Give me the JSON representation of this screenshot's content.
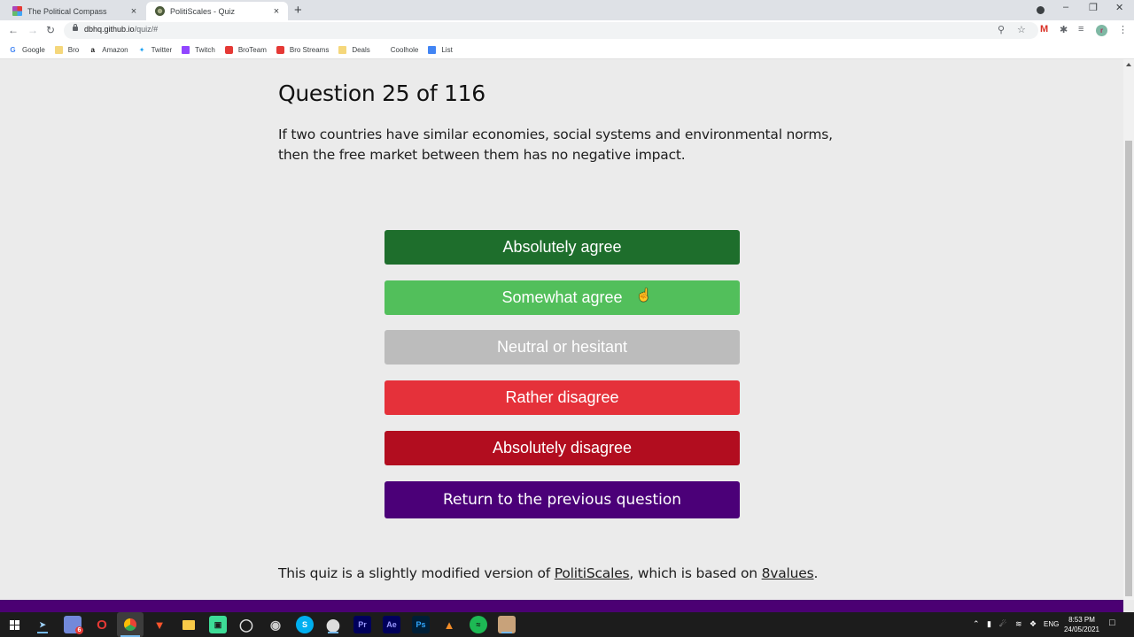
{
  "browser": {
    "tabs": [
      {
        "title": "The Political Compass",
        "active": false,
        "favicon": "political-compass-favicon"
      },
      {
        "title": "PolitiScales - Quiz",
        "active": true,
        "favicon": "politiscales-favicon"
      }
    ],
    "new_tab_label": "+",
    "close_glyph": "×",
    "url_host": "dbhq.github.io",
    "url_path": "/quiz/#",
    "window_controls": {
      "minimize": "–",
      "restore": "❐",
      "close": "✕"
    },
    "bookmarks": [
      {
        "label": "Google",
        "icon": "google-icon"
      },
      {
        "label": "Bro",
        "icon": "folder-icon"
      },
      {
        "label": "Amazon",
        "icon": "amazon-icon"
      },
      {
        "label": "Twitter",
        "icon": "twitter-icon"
      },
      {
        "label": "Twitch",
        "icon": "twitch-icon"
      },
      {
        "label": "BroTeam",
        "icon": "youtube-icon"
      },
      {
        "label": "Bro Streams",
        "icon": "youtube-icon"
      },
      {
        "label": "Deals",
        "icon": "folder-icon"
      },
      {
        "label": "Coolhole",
        "icon": "none"
      },
      {
        "label": "List",
        "icon": "docs-icon"
      }
    ],
    "profile_initial": "r"
  },
  "quiz": {
    "title": "Question 25 of 116",
    "question": "If two countries have similar economies, social systems and environmental norms, then the free market between them has no negative impact.",
    "answers": [
      {
        "label": "Absolutely agree",
        "color": "#1e6e2c"
      },
      {
        "label": "Somewhat agree",
        "color": "#52bf5b"
      },
      {
        "label": "Neutral or hesitant",
        "color": "#bcbcbc"
      },
      {
        "label": "Rather disagree",
        "color": "#e5313a"
      },
      {
        "label": "Absolutely disagree",
        "color": "#b20d1f"
      }
    ],
    "back_button": {
      "label": "Return to the previous question",
      "color": "#4b0078"
    },
    "footer": {
      "prefix": "This quiz is a slightly modified version of ",
      "link1": "PolitiScales",
      "middle": ", which is based on ",
      "link2": "8values",
      "suffix": "."
    }
  },
  "taskbar": {
    "apps": [
      "start",
      "steam",
      "discord",
      "opera",
      "chrome",
      "brave",
      "file-explorer",
      "app-green",
      "obs",
      "app-grid",
      "skype",
      "app-white",
      "premiere-pro",
      "after-effects",
      "photoshop",
      "fl-studio",
      "spotify",
      "app-avatar"
    ],
    "app_labels": {
      "skype": "S",
      "premiere": "Pr",
      "after_effects": "Ae",
      "photoshop": "Ps",
      "discord_badge": "6"
    },
    "tray": {
      "language": "ENG",
      "time": "8:53 PM",
      "date": "24/05/2021"
    }
  }
}
